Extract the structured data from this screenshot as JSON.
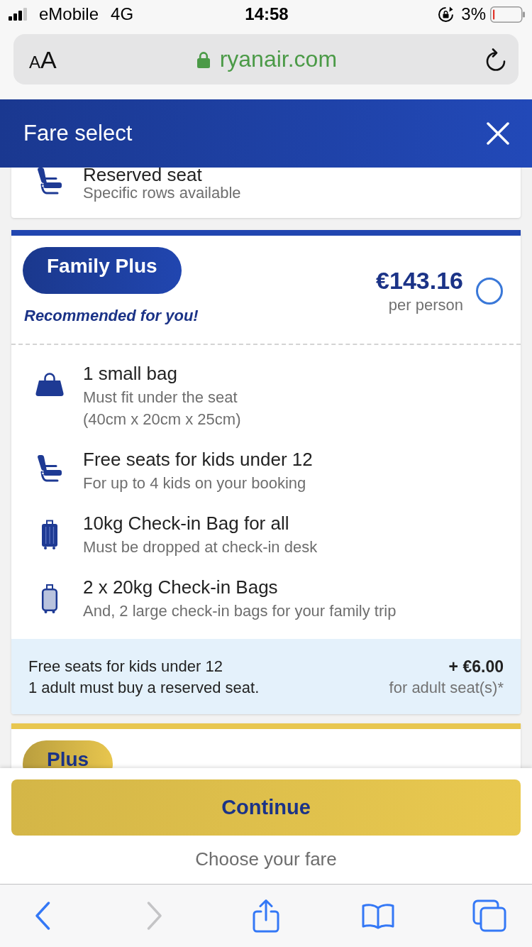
{
  "status_bar": {
    "carrier": "eMobile",
    "network": "4G",
    "time": "14:58",
    "battery": "3%"
  },
  "address_bar": {
    "reader_button": "AA",
    "url": "ryanair.com",
    "secure": true
  },
  "header": {
    "title": "Fare select"
  },
  "previous_fare": {
    "features": [
      {
        "kind": "seat",
        "title": "Reserved seat",
        "detail": "Specific rows available"
      }
    ]
  },
  "fares": [
    {
      "name": "Family Plus",
      "color": "#2146b0",
      "tagline": "Recommended for you!",
      "price": "€143.16",
      "price_unit": "per person",
      "selected": false,
      "features": [
        {
          "kind": "handbag",
          "title": "1 small bag",
          "detail": "Must fit under the seat\n(40cm x 20cm x 25cm)"
        },
        {
          "kind": "seat",
          "title": "Free seats for kids under 12",
          "detail": "For up to 4 kids on your booking"
        },
        {
          "kind": "suitcase",
          "title": "10kg Check-in Bag for all",
          "detail": "Must be dropped at check-in desk"
        },
        {
          "kind": "suitcase_outline",
          "title": "2 x 20kg Check-in Bags",
          "detail": "And, 2 large check-in bags for your family trip"
        }
      ],
      "note": {
        "title": "Free seats for kids under 12",
        "text": "1 adult must buy a reserved seat.",
        "price": "+ €6.00",
        "price_label": "for adult seat(s)*"
      }
    },
    {
      "name": "Plus",
      "color": "#e8c64e"
    }
  ],
  "footer": {
    "button": "Continue",
    "hint": "Choose your fare"
  },
  "toolbar": [
    {
      "kind": "back",
      "disabled": false
    },
    {
      "kind": "forward",
      "disabled": true
    },
    {
      "kind": "share",
      "disabled": false
    },
    {
      "kind": "bookmarks",
      "disabled": false
    },
    {
      "kind": "tabs",
      "disabled": false
    }
  ]
}
